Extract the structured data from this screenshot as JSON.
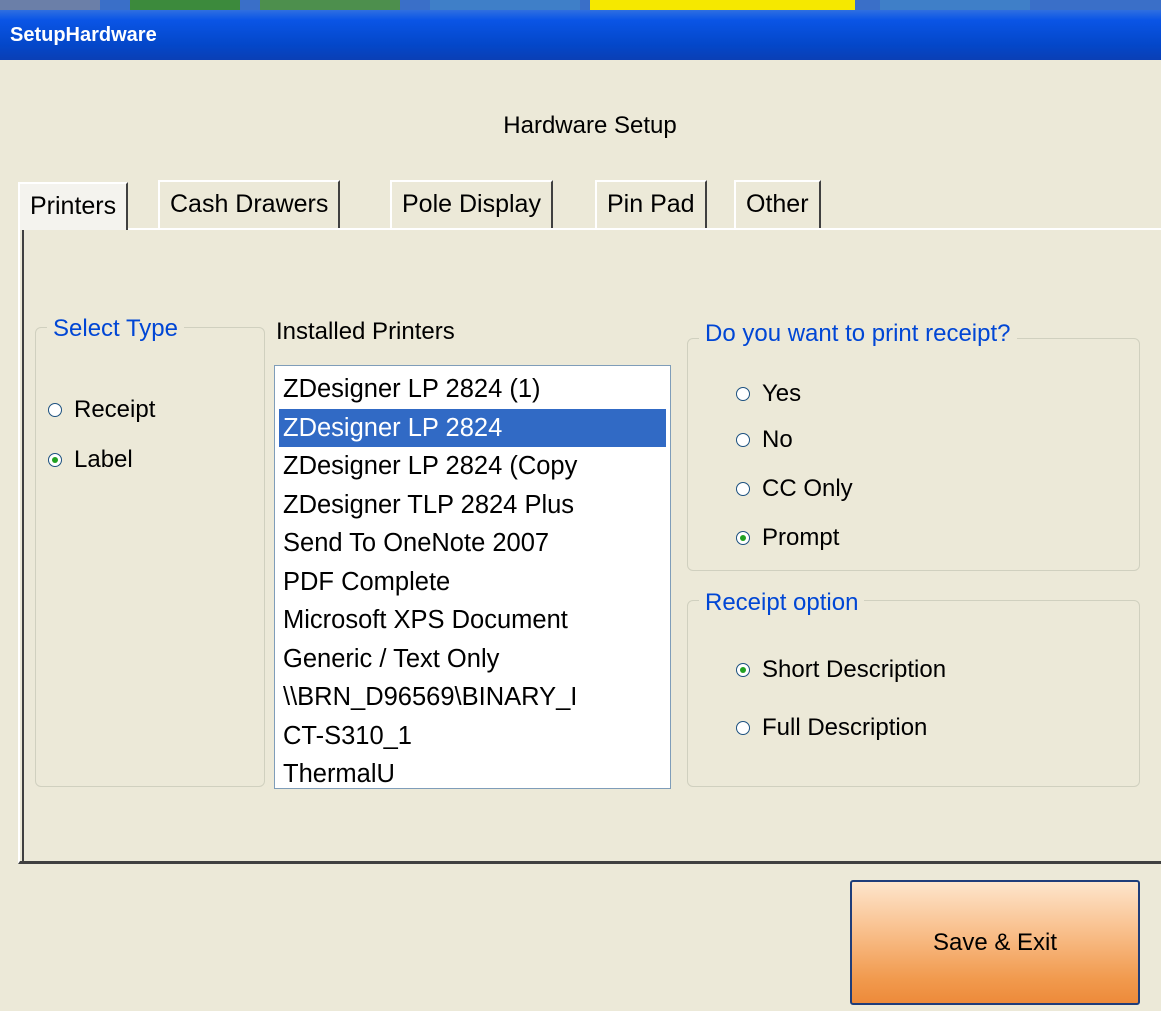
{
  "window": {
    "title": "SetupHardware"
  },
  "header": {
    "title": "Hardware Setup"
  },
  "tabs": [
    {
      "label": "Printers",
      "active": true
    },
    {
      "label": "Cash Drawers",
      "active": false
    },
    {
      "label": "Pole Display",
      "active": false
    },
    {
      "label": "Pin Pad",
      "active": false
    },
    {
      "label": "Other",
      "active": false
    }
  ],
  "select_type": {
    "title": "Select Type",
    "options": [
      {
        "label": "Receipt",
        "checked": false
      },
      {
        "label": "Label",
        "checked": true
      }
    ]
  },
  "installed_printers": {
    "label": "Installed Printers",
    "items": [
      "ZDesigner LP 2824 (1)",
      "ZDesigner LP 2824",
      "ZDesigner LP 2824 (Copy",
      "ZDesigner TLP 2824 Plus",
      "Send To OneNote 2007",
      "PDF Complete",
      "Microsoft XPS Document",
      "Generic / Text Only",
      "\\\\BRN_D96569\\BINARY_I",
      "CT-S310_1",
      "ThermalU"
    ],
    "selected_index": 1
  },
  "print_receipt": {
    "title": "Do you want to print receipt?",
    "options": [
      {
        "label": "Yes",
        "checked": false
      },
      {
        "label": "No",
        "checked": false
      },
      {
        "label": "CC Only",
        "checked": false
      },
      {
        "label": "Prompt",
        "checked": true
      }
    ]
  },
  "receipt_option": {
    "title": "Receipt option",
    "options": [
      {
        "label": "Short Description",
        "checked": true
      },
      {
        "label": "Full Description",
        "checked": false
      }
    ]
  },
  "footer": {
    "save_label": "Save & Exit"
  },
  "colors": {
    "title_bar": "#0a55e6",
    "group_title": "#0046d5",
    "selection": "#316ac5",
    "radio_dot": "#21a121",
    "save_button": "#f19a4e"
  }
}
